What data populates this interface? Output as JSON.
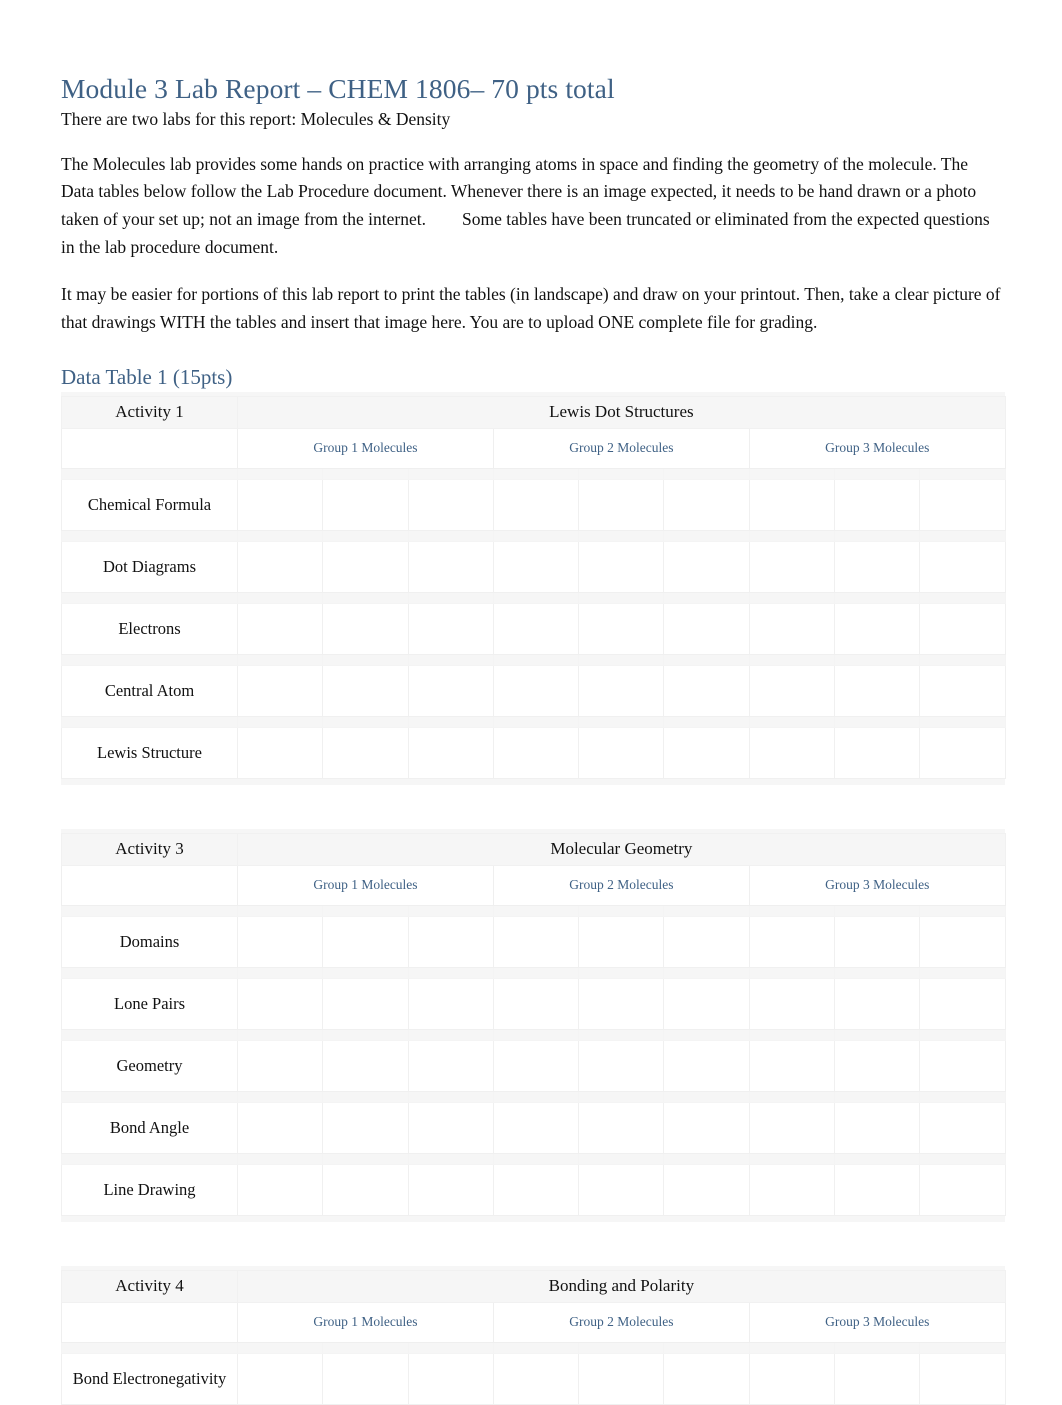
{
  "document": {
    "title": "Module 3 Lab Report  – CHEM 1806– 70 pts total",
    "subtitle": "There are two labs for this report: Molecules & Density",
    "paragraphs": [
      {
        "part1": "The Molecules lab provides some hands on practice with arranging atoms in space and finding the geometry of the molecule. The Data tables below follow the Lab Procedure document.  Whenever there is an image expected, it needs to be hand drawn or a photo taken of your set up; not an image from the internet.",
        "part2": "Some tables have been truncated or eliminated from the expected questions in the lab procedure document."
      },
      {
        "part1": "It may be easier for portions of this lab report to print the tables (in landscape) and draw on your printout. Then, take a clear picture of that drawings WITH the tables and insert that image here. You are to upload ONE complete file for grading.",
        "part2": ""
      }
    ],
    "section_heading": "Data Table 1 (15pts)"
  },
  "colors": {
    "heading_blue": "#3f6185",
    "group_label_blue": "#3f6185",
    "body_text": "#111111",
    "table_bg": "#f6f6f6",
    "cell_bg": "#ffffff",
    "border": "#ececec"
  },
  "group_headers": {
    "group1": "Group 1 Molecules",
    "group2": "Group 2 Molecules",
    "group3": "Group 3 Molecules"
  },
  "tables": [
    {
      "activity": "Activity 1",
      "title": "Lewis Dot Structures",
      "group_labels": [
        "Group 1 Molecules",
        "Group 2 Molecules",
        "Group 3 Molecules"
      ],
      "rows": [
        {
          "label": "Chemical Formula",
          "cells": [
            "",
            "",
            "",
            "",
            "",
            "",
            "",
            "",
            ""
          ]
        },
        {
          "label": "Dot Diagrams",
          "cells": [
            "",
            "",
            "",
            "",
            "",
            "",
            "",
            "",
            ""
          ]
        },
        {
          "label": "Electrons",
          "cells": [
            "",
            "",
            "",
            "",
            "",
            "",
            "",
            "",
            ""
          ]
        },
        {
          "label": "Central Atom",
          "cells": [
            "",
            "",
            "",
            "",
            "",
            "",
            "",
            "",
            ""
          ]
        },
        {
          "label": "Lewis Structure",
          "cells": [
            "",
            "",
            "",
            "",
            "",
            "",
            "",
            "",
            ""
          ]
        }
      ]
    },
    {
      "activity": "Activity 3",
      "title": "Molecular Geometry",
      "group_labels": [
        "Group 1 Molecules",
        "Group 2 Molecules",
        "Group 3 Molecules"
      ],
      "rows": [
        {
          "label": "Domains",
          "cells": [
            "",
            "",
            "",
            "",
            "",
            "",
            "",
            "",
            ""
          ]
        },
        {
          "label": "Lone Pairs",
          "cells": [
            "",
            "",
            "",
            "",
            "",
            "",
            "",
            "",
            ""
          ]
        },
        {
          "label": "Geometry",
          "cells": [
            "",
            "",
            "",
            "",
            "",
            "",
            "",
            "",
            ""
          ]
        },
        {
          "label": "Bond Angle",
          "cells": [
            "",
            "",
            "",
            "",
            "",
            "",
            "",
            "",
            ""
          ]
        },
        {
          "label": "Line Drawing",
          "cells": [
            "",
            "",
            "",
            "",
            "",
            "",
            "",
            "",
            ""
          ]
        }
      ]
    },
    {
      "activity": "Activity 4",
      "title": "Bonding and Polarity",
      "group_labels": [
        "Group 1 Molecules",
        "Group 2 Molecules",
        "Group 3 Molecules"
      ],
      "rows": [
        {
          "label": "Bond Electronegativity",
          "cells": [
            "",
            "",
            "",
            "",
            "",
            "",
            "",
            "",
            ""
          ]
        }
      ]
    }
  ]
}
